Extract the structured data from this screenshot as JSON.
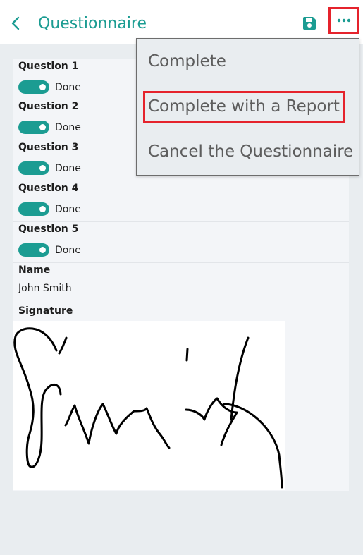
{
  "header": {
    "title": "Questionnaire",
    "back_icon": "chevron-left-icon",
    "save_icon": "save-icon",
    "more_icon": "more-horizontal-icon"
  },
  "questions": [
    {
      "label": "Question 1",
      "toggle_text": "Done",
      "checked": true
    },
    {
      "label": "Question 2",
      "toggle_text": "Done",
      "checked": true
    },
    {
      "label": "Question 3",
      "toggle_text": "Done",
      "checked": true
    },
    {
      "label": "Question 4",
      "toggle_text": "Done",
      "checked": true
    },
    {
      "label": "Question 5",
      "toggle_text": "Done",
      "checked": true
    }
  ],
  "name": {
    "label": "Name",
    "value": "John Smith"
  },
  "signature": {
    "label": "Signature",
    "signed_text": "Smith"
  },
  "menu": {
    "items": [
      "Complete",
      "Complete with a Report",
      "Cancel the Questionnaire"
    ],
    "highlighted_index": 1
  },
  "colors": {
    "accent": "#1b9c92",
    "highlight": "#e5232c",
    "background": "#e9edf0"
  }
}
